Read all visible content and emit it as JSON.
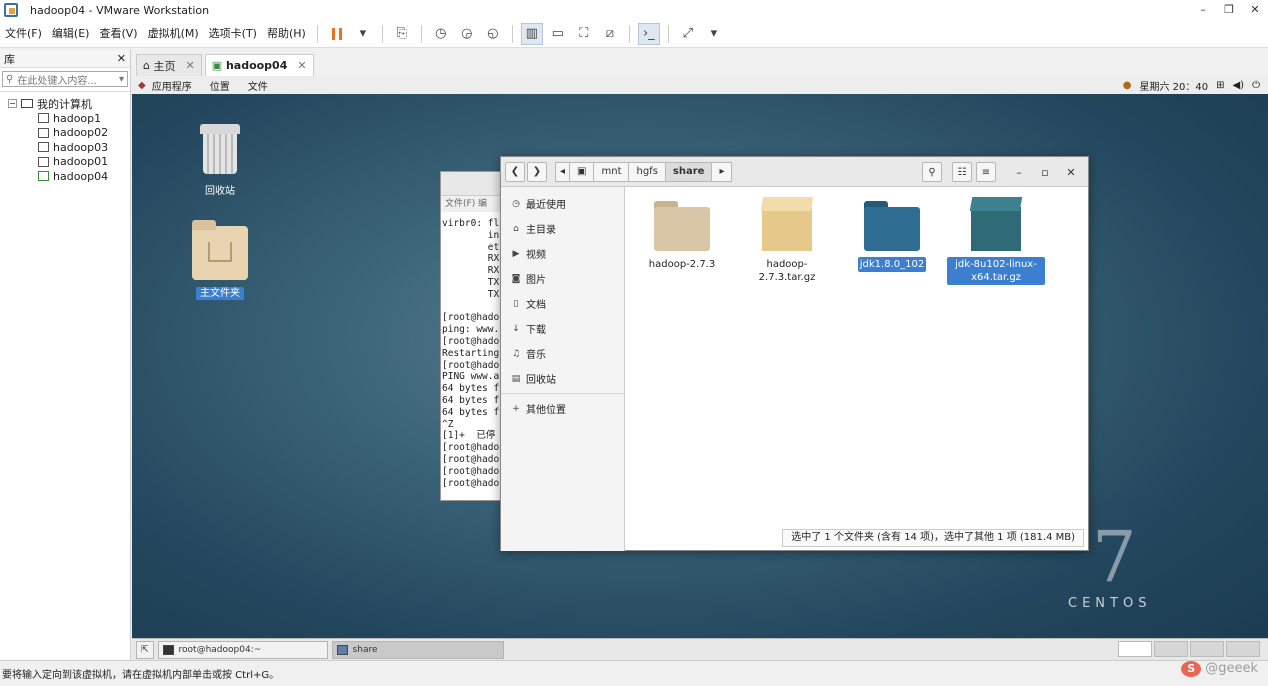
{
  "window": {
    "title": "hadoop04 - VMware Workstation",
    "min": "–",
    "max": "❐",
    "close": "✕"
  },
  "menu": [
    "文件(F)",
    "编辑(E)",
    "查看(V)",
    "虚拟机(M)",
    "选项卡(T)",
    "帮助(H)"
  ],
  "library": {
    "title": "库",
    "close": "✕",
    "search_placeholder": "在此处键入内容...",
    "root": "我的计算机",
    "expander": "−",
    "vms": [
      "hadoop1",
      "hadoop02",
      "hadoop03",
      "hadoop01",
      "hadoop04"
    ],
    "running_vm": "hadoop04"
  },
  "tabs": [
    {
      "label": "主页",
      "close": "✕"
    },
    {
      "label": "hadoop04",
      "close": "✕"
    }
  ],
  "gnome": {
    "menus": [
      "应用程序",
      "位置",
      "文件"
    ],
    "clock": "星期六 20：40"
  },
  "desktop": {
    "trash_label": "回收站",
    "home_label": "主文件夹",
    "brand": "CENTOS",
    "brand_number": "7"
  },
  "terminal": {
    "menu": "文件(F)  编",
    "lines": [
      "virbr0: fl",
      "        in",
      "        et",
      "        RX",
      "        RX",
      "        TX",
      "        TX",
      "",
      "[root@hado",
      "ping: www.",
      "[root@hado",
      "Restarting",
      "[root@hado",
      "PING www.a",
      "64 bytes f",
      "64 bytes f",
      "64 bytes f",
      "^Z",
      "[1]+  已停",
      "[root@hado",
      "[root@hado",
      "[root@hado",
      "[root@hado"
    ]
  },
  "files": {
    "breadcrumbs": [
      "mnt",
      "hgfs",
      "share"
    ],
    "sidebar": [
      {
        "icon": "◷",
        "label": "最近使用"
      },
      {
        "icon": "⌂",
        "label": "主目录"
      },
      {
        "icon": "▶",
        "label": "视频"
      },
      {
        "icon": "◙",
        "label": "图片"
      },
      {
        "icon": "▯",
        "label": "文档"
      },
      {
        "icon": "↓",
        "label": "下载"
      },
      {
        "icon": "♫",
        "label": "音乐"
      },
      {
        "icon": "▤",
        "label": "回收站"
      }
    ],
    "other_locations": {
      "icon": "+",
      "label": "其他位置"
    },
    "items": [
      {
        "name": "hadoop-2.7.3",
        "kind": "folder",
        "color": "#d9c6a6",
        "selected": false
      },
      {
        "name": "hadoop-2.7.3.tar.gz",
        "kind": "archive",
        "color": "#e6c98a",
        "selected": false
      },
      {
        "name": "jdk1.8.0_102",
        "kind": "folder",
        "color": "#2f6d93",
        "selected": true
      },
      {
        "name": "jdk-8u102-linux-x64.tar.gz",
        "kind": "archive",
        "color": "#2e6b76",
        "selected": true
      }
    ],
    "status": "选中了 1 个文件夹 (含有 14 项)，选中了其他 1 项 (181.4 MB)"
  },
  "guest_taskbar": [
    {
      "label": "root@hadoop04:~",
      "active": false
    },
    {
      "label": "share",
      "active": true
    }
  ],
  "statusbar": {
    "hint": "要将输入定向到该虚拟机，请在虚拟机内部单击或按 Ctrl+G。",
    "watermark": "@geeek",
    "watermark_logo": "S"
  }
}
